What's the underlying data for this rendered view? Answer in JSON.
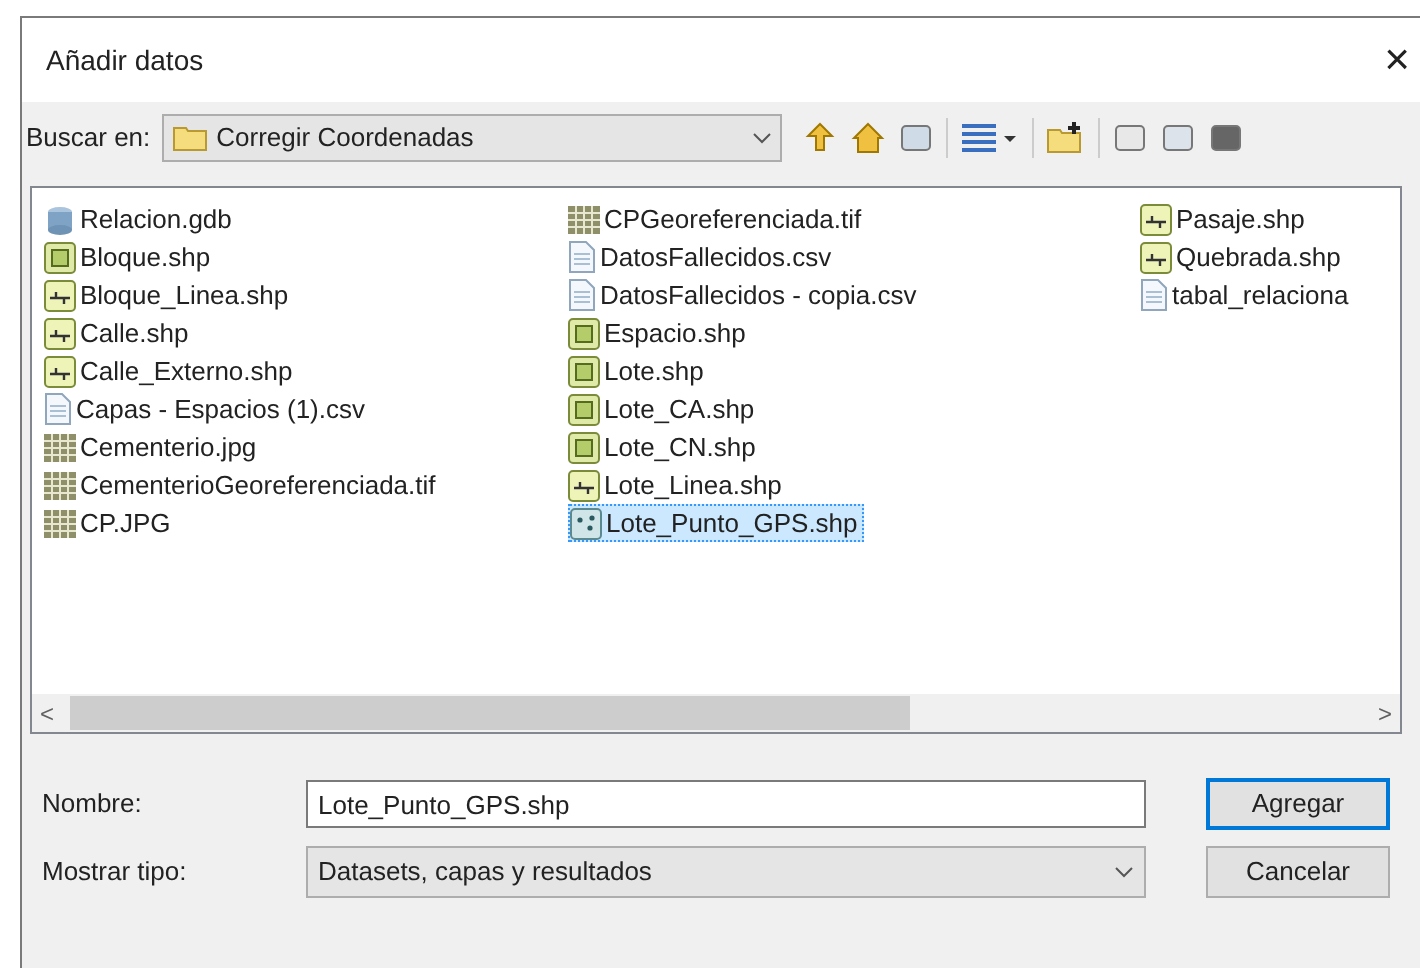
{
  "window": {
    "title": "Añadir datos",
    "close": "×"
  },
  "toolbar": {
    "label": "Buscar en:",
    "location": "Corregir Coordenadas"
  },
  "files": [
    {
      "name": "Relacion.gdb",
      "kind": "gdb",
      "selected": false
    },
    {
      "name": "Bloque.shp",
      "kind": "polygon",
      "selected": false
    },
    {
      "name": "Bloque_Linea.shp",
      "kind": "line",
      "selected": false
    },
    {
      "name": "Calle.shp",
      "kind": "line",
      "selected": false
    },
    {
      "name": "Calle_Externo.shp",
      "kind": "line",
      "selected": false
    },
    {
      "name": "Capas - Espacios (1).csv",
      "kind": "table",
      "selected": false
    },
    {
      "name": "Cementerio.jpg",
      "kind": "raster",
      "selected": false
    },
    {
      "name": "CementerioGeoreferenciada.tif",
      "kind": "raster",
      "selected": false
    },
    {
      "name": "CP.JPG",
      "kind": "raster",
      "selected": false
    },
    {
      "name": "CPGeoreferenciada.tif",
      "kind": "raster",
      "selected": false
    },
    {
      "name": "DatosFallecidos.csv",
      "kind": "table",
      "selected": false
    },
    {
      "name": "DatosFallecidos - copia.csv",
      "kind": "table",
      "selected": false
    },
    {
      "name": "Espacio.shp",
      "kind": "polygon",
      "selected": false
    },
    {
      "name": "Lote.shp",
      "kind": "polygon",
      "selected": false
    },
    {
      "name": "Lote_CA.shp",
      "kind": "polygon",
      "selected": false
    },
    {
      "name": "Lote_CN.shp",
      "kind": "polygon",
      "selected": false
    },
    {
      "name": "Lote_Linea.shp",
      "kind": "line",
      "selected": false
    },
    {
      "name": "Lote_Punto_GPS.shp",
      "kind": "point",
      "selected": true
    },
    {
      "name": "Pasaje.shp",
      "kind": "line",
      "selected": false
    },
    {
      "name": "Quebrada.shp",
      "kind": "line",
      "selected": false
    },
    {
      "name": "tabal_relaciona",
      "kind": "table",
      "selected": false
    }
  ],
  "scrollbar": {
    "left": "<",
    "right": ">"
  },
  "name_field": {
    "label": "Nombre:",
    "value": "Lote_Punto_GPS.shp"
  },
  "type_field": {
    "label": "Mostrar tipo:",
    "value": "Datasets, capas y resultados"
  },
  "buttons": [
    {
      "label": "Agregar",
      "default": true
    },
    {
      "label": "Cancelar",
      "default": false
    }
  ]
}
